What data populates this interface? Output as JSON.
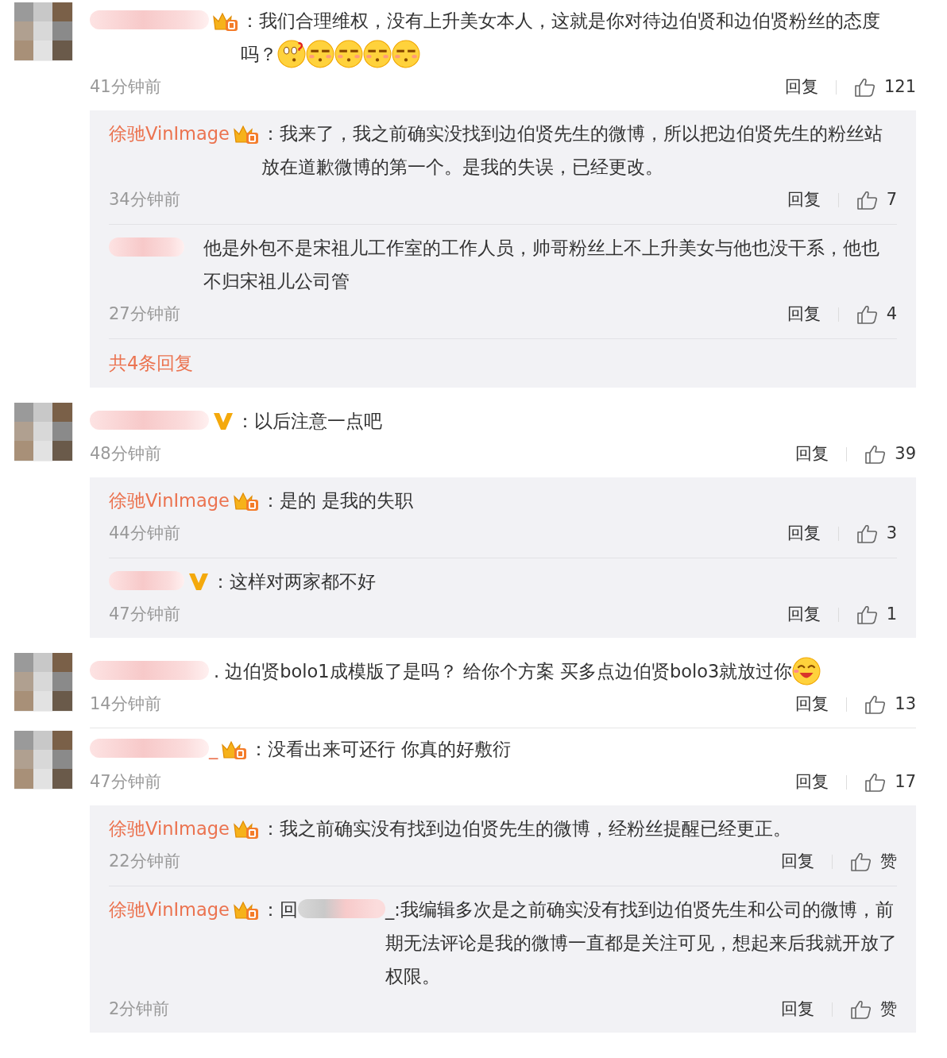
{
  "comments": [
    {
      "kind": "crown",
      "text": "：我们合理维权，没有上升美女本人，这就是你对待边伯贤和边伯贤粉丝的态度吗？",
      "emojis": [
        {
          "kind": "confused"
        },
        {
          "kind": "doubt"
        },
        {
          "kind": "doubt"
        },
        {
          "kind": "doubt"
        },
        {
          "kind": "doubt"
        }
      ],
      "time": "41分钟前",
      "reply_label": "回复",
      "likes": "121",
      "replies": [
        {
          "name": "徐驰VinImage",
          "kind": "crown",
          "text": "：我来了，我之前确实没找到边伯贤先生的微博，所以把边伯贤先生的粉丝站放在道歉微博的第一个。是我的失误，已经更改。",
          "time": "34分钟前",
          "reply_label": "回复",
          "likes": "7"
        },
        {
          "kind": "plain",
          "text": "他是外包不是宋祖儿工作室的工作人员，帅哥粉丝上不上升美女与他也没干系，他也不归宋祖儿公司管",
          "time": "27分钟前",
          "reply_label": "回复",
          "likes": "4"
        }
      ],
      "more": "共4条回复"
    },
    {
      "kind": "verified",
      "text": "：以后注意一点吧",
      "time": "48分钟前",
      "reply_label": "回复",
      "likes": "39",
      "replies": [
        {
          "name": "徐驰VinImage",
          "kind": "crown",
          "text": "：是的 是我的失职",
          "time": "44分钟前",
          "reply_label": "回复",
          "likes": "3"
        },
        {
          "kind": "verified",
          "text": "：这样对两家都不好",
          "time": "47分钟前",
          "reply_label": "回复",
          "likes": "1"
        }
      ]
    },
    {
      "kind": "plain",
      "text": ". 边伯贤bolo1成模版了是吗？ 给你个方案 买多点边伯贤bolo3就放过你",
      "emojis": [
        {
          "kind": "laugh"
        }
      ],
      "time": "14分钟前",
      "reply_label": "回复",
      "likes": "13",
      "divider": true
    },
    {
      "kind": "crown",
      "name_suffix": "_",
      "text": "：没看出来可还行 你真的好敷衍",
      "time": "47分钟前",
      "reply_label": "回复",
      "likes": "17",
      "replies": [
        {
          "name": "徐驰VinImage",
          "kind": "crown",
          "text": "：我之前确实没有找到边伯贤先生的微博，经粉丝提醒已经更正。",
          "time": "22分钟前",
          "reply_label": "回复",
          "likes": "赞"
        },
        {
          "name": "徐驰VinImage",
          "kind": "crown",
          "text": "：",
          "mention_prefix": "回",
          "mention_text": "_:我编辑多次是之前确实没有找到边伯贤先生和公司的微博，前期无法评论是我的微博一直都是关注可见，想起来后我就开放了权限。",
          "time": "2分钟前",
          "reply_label": "回复",
          "likes": "赞"
        }
      ]
    }
  ]
}
